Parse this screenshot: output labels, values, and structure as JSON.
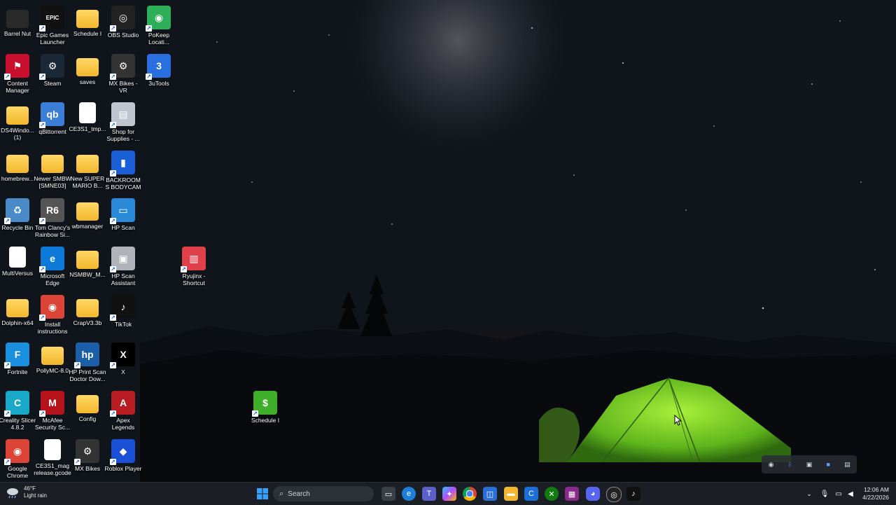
{
  "desktop": {
    "icons": [
      {
        "label": "Barrel Nut"
      },
      {
        "label": "Epic Games Launcher"
      },
      {
        "label": "Schedule I"
      },
      {
        "label": "OBS Studio"
      },
      {
        "label": "PoKeep Locati..."
      },
      {
        "label": "Content Manager"
      },
      {
        "label": "Steam"
      },
      {
        "label": "saves"
      },
      {
        "label": "MX Bikes - VR"
      },
      {
        "label": "3uTools"
      },
      {
        "label": "DS4Windo... (1)"
      },
      {
        "label": "qBittorrent"
      },
      {
        "label": "CE3S1_tmp..."
      },
      {
        "label": "Shop for Supplies - ..."
      },
      {
        "label": "homebrew..."
      },
      {
        "label": "Newer SMBW [SMNE03]"
      },
      {
        "label": "New SUPER MARIO B..."
      },
      {
        "label": "BACKROOMS BODYCAM"
      },
      {
        "label": "Recycle Bin"
      },
      {
        "label": "Tom Clancy's Rainbow Si..."
      },
      {
        "label": "wbmanager"
      },
      {
        "label": "HP Scan"
      },
      {
        "label": "MultiVersus"
      },
      {
        "label": "Microsoft Edge"
      },
      {
        "label": "NSMBW_M..."
      },
      {
        "label": "HP Scan Assistant"
      },
      {
        "label": "Ryujinx - Shortcut"
      },
      {
        "label": "Dolphin-x64"
      },
      {
        "label": "Install instructions"
      },
      {
        "label": "CrapV3.3b"
      },
      {
        "label": "TikTok"
      },
      {
        "label": "Fortnite"
      },
      {
        "label": "PollyMC-8.0"
      },
      {
        "label": "HP Print Scan Doctor Dow..."
      },
      {
        "label": "X"
      },
      {
        "label": "Creality Slicer 4.8.2"
      },
      {
        "label": "McAfee Security Sc..."
      },
      {
        "label": "Config"
      },
      {
        "label": "Apex Legends"
      },
      {
        "label": "Schedule I"
      },
      {
        "label": "Google Chrome"
      },
      {
        "label": "CE3S1_mag release.gcode"
      },
      {
        "label": "MX Bikes"
      },
      {
        "label": "Roblox Player"
      }
    ]
  },
  "taskbar": {
    "weather": {
      "temp": "46°F",
      "condition": "Light rain"
    },
    "search_placeholder": "Search",
    "clock": {
      "time": "12:06 AM",
      "date": "4/22/2026"
    },
    "pinned": [
      "start",
      "search",
      "task-view",
      "edge",
      "teams",
      "copilot",
      "chrome",
      "store",
      "file-explorer",
      "ccleaner",
      "xbox",
      "winrar",
      "discord",
      "obs",
      "tiktok"
    ]
  },
  "colors": {
    "taskbar_bg": "#1b1e24",
    "accent": "#3a8ee6"
  }
}
